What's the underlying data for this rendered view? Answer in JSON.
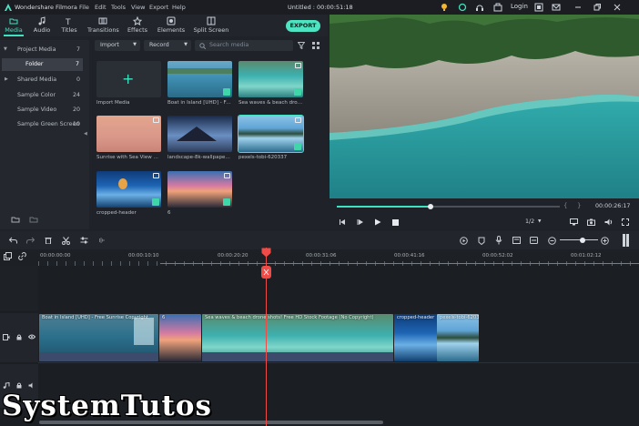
{
  "app": {
    "name": "Wondershare Filmora",
    "project_title": "Untitled : 00:00:51:18",
    "login": "Login"
  },
  "menu": [
    "File",
    "Edit",
    "Tools",
    "View",
    "Export",
    "Help"
  ],
  "tabs": [
    {
      "label": "Media",
      "icon": "folder-icon",
      "active": true
    },
    {
      "label": "Audio",
      "icon": "music-note-icon"
    },
    {
      "label": "Titles",
      "icon": "text-icon"
    },
    {
      "label": "Transitions",
      "icon": "transition-icon"
    },
    {
      "label": "Effects",
      "icon": "effects-icon"
    },
    {
      "label": "Elements",
      "icon": "elements-icon"
    },
    {
      "label": "Split Screen",
      "icon": "split-screen-icon"
    }
  ],
  "export_label": "EXPORT",
  "sidebar": {
    "items": [
      {
        "label": "Project Media",
        "count": "7"
      },
      {
        "label": "Folder",
        "count": "7"
      },
      {
        "label": "Shared Media",
        "count": "0"
      },
      {
        "label": "Sample Color",
        "count": "24"
      },
      {
        "label": "Sample Video",
        "count": "20"
      },
      {
        "label": "Sample Green Screen",
        "count": "10"
      }
    ]
  },
  "media": {
    "import_label": "Import",
    "record_label": "Record",
    "search_placeholder": "Search media",
    "items": [
      {
        "caption": "Import Media"
      },
      {
        "caption": "Boat in Island [UHD] - Fr...",
        "colors": [
          "#3f8fb4",
          "#7ab7cf",
          "#2b6b86"
        ]
      },
      {
        "caption": "Sea waves & beach dron...",
        "colors": [
          "#3db0ae",
          "#7fd6c9",
          "#2b7f7f"
        ]
      },
      {
        "caption": "Sunrise with Sea View Ti...",
        "colors": [
          "#e3a58d",
          "#d9978a",
          "#c98577"
        ]
      },
      {
        "caption": "landscape-8k-wallpapers...",
        "colors": [
          "#23304f",
          "#6a8fc3",
          "#3a4a68"
        ]
      },
      {
        "caption": "pexels-tobi-620337",
        "colors": [
          "#5fa4d6",
          "#9fd2ec",
          "#2c6b8d"
        ]
      },
      {
        "caption": "cropped-header",
        "colors": [
          "#1d64b4",
          "#6bb0e5",
          "#12406f"
        ]
      },
      {
        "caption": "6",
        "colors": [
          "#3a6fb1",
          "#d57aa2",
          "#6a5aa0"
        ]
      }
    ]
  },
  "preview": {
    "timecode": "00:00:26:17",
    "ratio": "1/2",
    "progress": 0.42
  },
  "timeline": {
    "ruler": [
      "00:00:00:00",
      "00:00:10:10",
      "00:00:20:20",
      "00:00:31:06",
      "00:00:41:16",
      "00:00:52:02",
      "00:01:02:12"
    ],
    "clips": [
      {
        "title": "Boat in Island [UHD] - Free Sunrise Copyright"
      },
      {
        "title": "6"
      },
      {
        "title": "Sea waves & beach drone shots! Free HD Stock Footage (No Copyright)"
      },
      {
        "title": "cropped-header"
      },
      {
        "title": "pexels-tobi-620337"
      }
    ]
  },
  "watermark": "SystemTutos",
  "colors": {
    "accent": "#3fe2c0",
    "playhead": "#ef4b47",
    "export": "#4ee3c1"
  }
}
